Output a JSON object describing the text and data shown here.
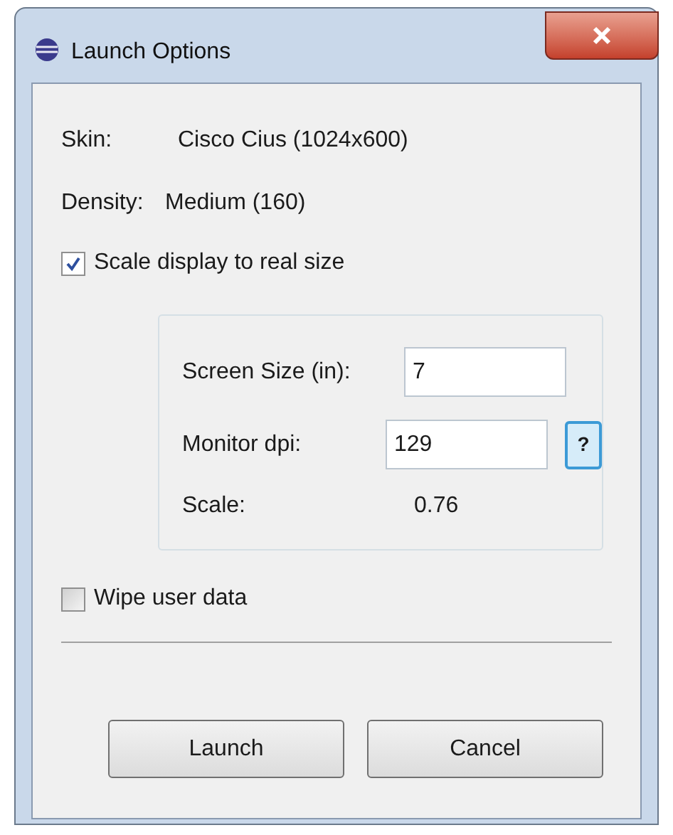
{
  "window": {
    "title": "Launch Options"
  },
  "info": [
    {
      "label": "Skin:",
      "value": "Cisco Cius (1024x600)"
    },
    {
      "label": "Density:",
      "value": "Medium (160)"
    }
  ],
  "scale_checkbox": {
    "label": "Scale display to real size",
    "checked": true
  },
  "scale_group": {
    "screen_size": {
      "label": "Screen Size (in):",
      "value": "7"
    },
    "monitor_dpi": {
      "label": "Monitor dpi:",
      "value": "129",
      "help": "?"
    },
    "scale": {
      "label": "Scale:",
      "value": "0.76"
    }
  },
  "wipe_checkbox": {
    "label": "Wipe user data",
    "checked": false
  },
  "buttons": [
    {
      "label": "Launch"
    },
    {
      "label": "Cancel"
    }
  ]
}
